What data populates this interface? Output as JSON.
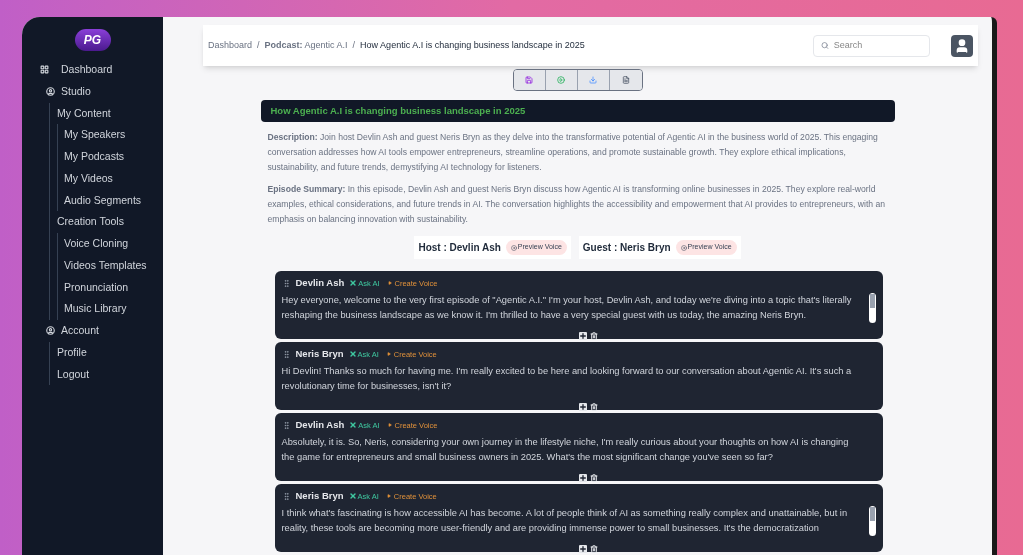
{
  "sidebar": {
    "logo": "PG",
    "nav": [
      {
        "label": "Dashboard",
        "kind": "dashboard"
      },
      {
        "label": "Studio",
        "kind": "section",
        "children": [
          {
            "label": "My Content",
            "children": [
              {
                "label": "My Speakers"
              },
              {
                "label": "My Podcasts"
              },
              {
                "label": "My Videos"
              },
              {
                "label": "Audio Segments"
              }
            ]
          },
          {
            "label": "Creation Tools",
            "children": [
              {
                "label": "Voice Cloning"
              },
              {
                "label": "Videos Templates"
              },
              {
                "label": "Pronunciation"
              },
              {
                "label": "Music Library"
              }
            ]
          }
        ]
      },
      {
        "label": "Account",
        "kind": "section",
        "children": [
          {
            "label": "Profile"
          },
          {
            "label": "Logout"
          }
        ]
      }
    ]
  },
  "breadcrumb_separator": "/",
  "breadcrumb": [
    "Dashboard",
    "**Podcast:** Agentic A.I",
    "How Agentic A.I is changing business landscape in 2025"
  ],
  "search": {
    "placeholder": "Search"
  },
  "title": "How Agentic A.I is changing business landscape in 2025",
  "description": "**Description:** Join host Devlin Ash and guest Neris Bryn as they delve into the transformative potential of Agentic AI in the business world of 2025. This engaging conversation addresses how AI tools empower entrepreneurs, streamline operations, and promote sustainable growth. They explore ethical implications, sustainability, and future trends, demystifying AI technology for listeners.",
  "summary": "**Episode Summary:** In this episode, Devlin Ash and guest Neris Bryn discuss how Agentic AI is transforming online businesses in 2025. They explore real-world examples, ethical considerations, and future trends in AI. The conversation highlights the accessibility and empowerment that AI provides to entrepreneurs, with an emphasis on balancing innovation with sustainability.",
  "speakers": [
    {
      "label": "Host : Devlin Ash",
      "button": "Preview Voice"
    },
    {
      "label": "Guest : Neris Bryn",
      "button": "Preview Voice"
    }
  ],
  "dialogue": [
    {
      "speaker": "Devlin Ash",
      "ask_ai": "Ask AI",
      "create_voice": "Create Voice",
      "text": "Hey everyone, welcome to the very first episode of \"Agentic A.I.\" I'm your host, Devlin Ash, and today we're diving into a topic that's literally reshaping the business landscape as we know it. I'm thrilled to have a very special guest with us today, the amazing Neris Bryn.",
      "scrollable": true
    },
    {
      "speaker": "Neris Bryn",
      "ask_ai": "Ask AI",
      "create_voice": "Create Voice",
      "text": "Hi Devlin! Thanks so much for having me. I'm really excited to be here and looking forward to our conversation about Agentic AI. It's such a revolutionary time for businesses, isn't it?",
      "scrollable": false
    },
    {
      "speaker": "Devlin Ash",
      "ask_ai": "Ask AI",
      "create_voice": "Create Voice",
      "text": "Absolutely, it is. So, Neris, considering your own journey in the lifestyle niche, I'm really curious about your thoughts on how AI is changing the game for entrepreneurs and small business owners in 2025. What's the most significant change you've seen so far?",
      "scrollable": false
    },
    {
      "speaker": "Neris Bryn",
      "ask_ai": "Ask AI",
      "create_voice": "Create Voice",
      "text": "I think what's fascinating is how accessible AI has become. A lot of people think of AI as something really complex and unattainable, but in reality, these tools are becoming more user-friendly and are providing immense power to small businesses. It's the democratization",
      "scrollable": true
    }
  ]
}
